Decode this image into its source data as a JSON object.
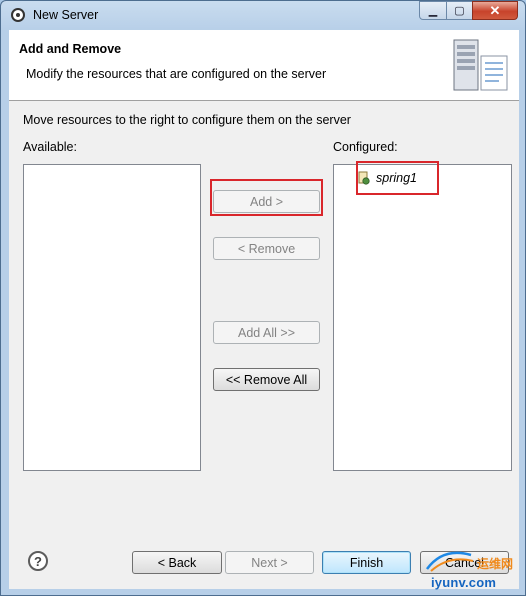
{
  "window": {
    "title": "New Server",
    "minimize_glyph": "▁",
    "maximize_glyph": "▢",
    "close_glyph": "✕"
  },
  "header": {
    "heading": "Add and Remove",
    "description": "Modify the resources that are configured on the server"
  },
  "content": {
    "instruction": "Move resources to the right to configure them on the server",
    "available_label": "Available:",
    "configured_label": "Configured:",
    "available_items": [],
    "configured_items": [
      {
        "label": "spring1",
        "icon": "project-icon"
      }
    ]
  },
  "move_buttons": {
    "add": "Add >",
    "remove": "< Remove",
    "add_all": "Add All >>",
    "remove_all": "<< Remove All"
  },
  "footer": {
    "help": "?",
    "back": "< Back",
    "next": "Next >",
    "finish": "Finish",
    "cancel": "Cancel"
  },
  "watermark": {
    "brand_cn": "运维网",
    "url": "iyunv.com"
  },
  "colors": {
    "highlight": "#d9262b",
    "frame": "#b7cfe8",
    "dialog_bg": "#f0f0f0"
  }
}
